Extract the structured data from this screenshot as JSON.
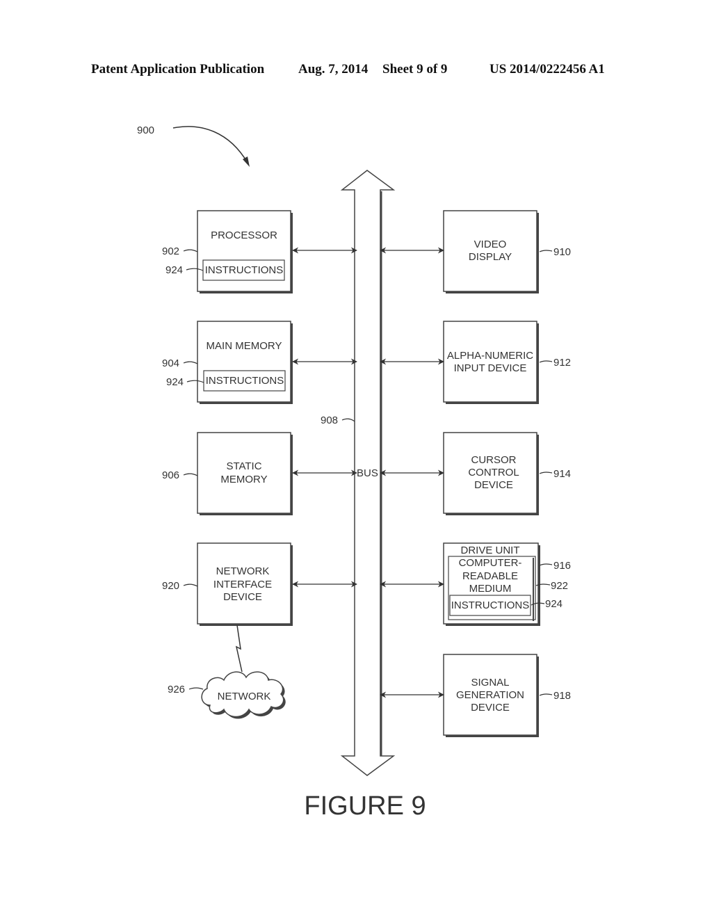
{
  "header": {
    "left": "Patent Application Publication",
    "date": "Aug. 7, 2014",
    "sheet": "Sheet 9 of 9",
    "number": "US 2014/0222456 A1"
  },
  "figure": {
    "title": "FIGURE 9",
    "ref_main": "900",
    "bus": {
      "label": "BUS",
      "ref": "908"
    },
    "left_blocks": [
      {
        "ref": "902",
        "lines": [
          "PROCESSOR"
        ],
        "inner": {
          "label": "INSTRUCTIONS",
          "ref": "924"
        }
      },
      {
        "ref": "904",
        "lines": [
          "MAIN MEMORY"
        ],
        "inner": {
          "label": "INSTRUCTIONS",
          "ref": "924"
        }
      },
      {
        "ref": "906",
        "lines": [
          "STATIC",
          "MEMORY"
        ]
      },
      {
        "ref": "920",
        "lines": [
          "NETWORK",
          "INTERFACE",
          "DEVICE"
        ]
      }
    ],
    "right_blocks": [
      {
        "ref": "910",
        "lines": [
          "VIDEO",
          "DISPLAY"
        ]
      },
      {
        "ref": "912",
        "lines": [
          "ALPHA-NUMERIC",
          "INPUT DEVICE"
        ]
      },
      {
        "ref": "914",
        "lines": [
          "CURSOR",
          "CONTROL",
          "DEVICE"
        ]
      },
      {
        "ref": "916",
        "title": "DRIVE UNIT",
        "medium": {
          "ref": "922",
          "lines": [
            "COMPUTER-",
            "READABLE",
            "MEDIUM"
          ]
        },
        "inner": {
          "label": "INSTRUCTIONS",
          "ref": "924"
        }
      },
      {
        "ref": "918",
        "lines": [
          "SIGNAL",
          "GENERATION",
          "DEVICE"
        ]
      }
    ],
    "network": {
      "label": "NETWORK",
      "ref": "926"
    }
  }
}
